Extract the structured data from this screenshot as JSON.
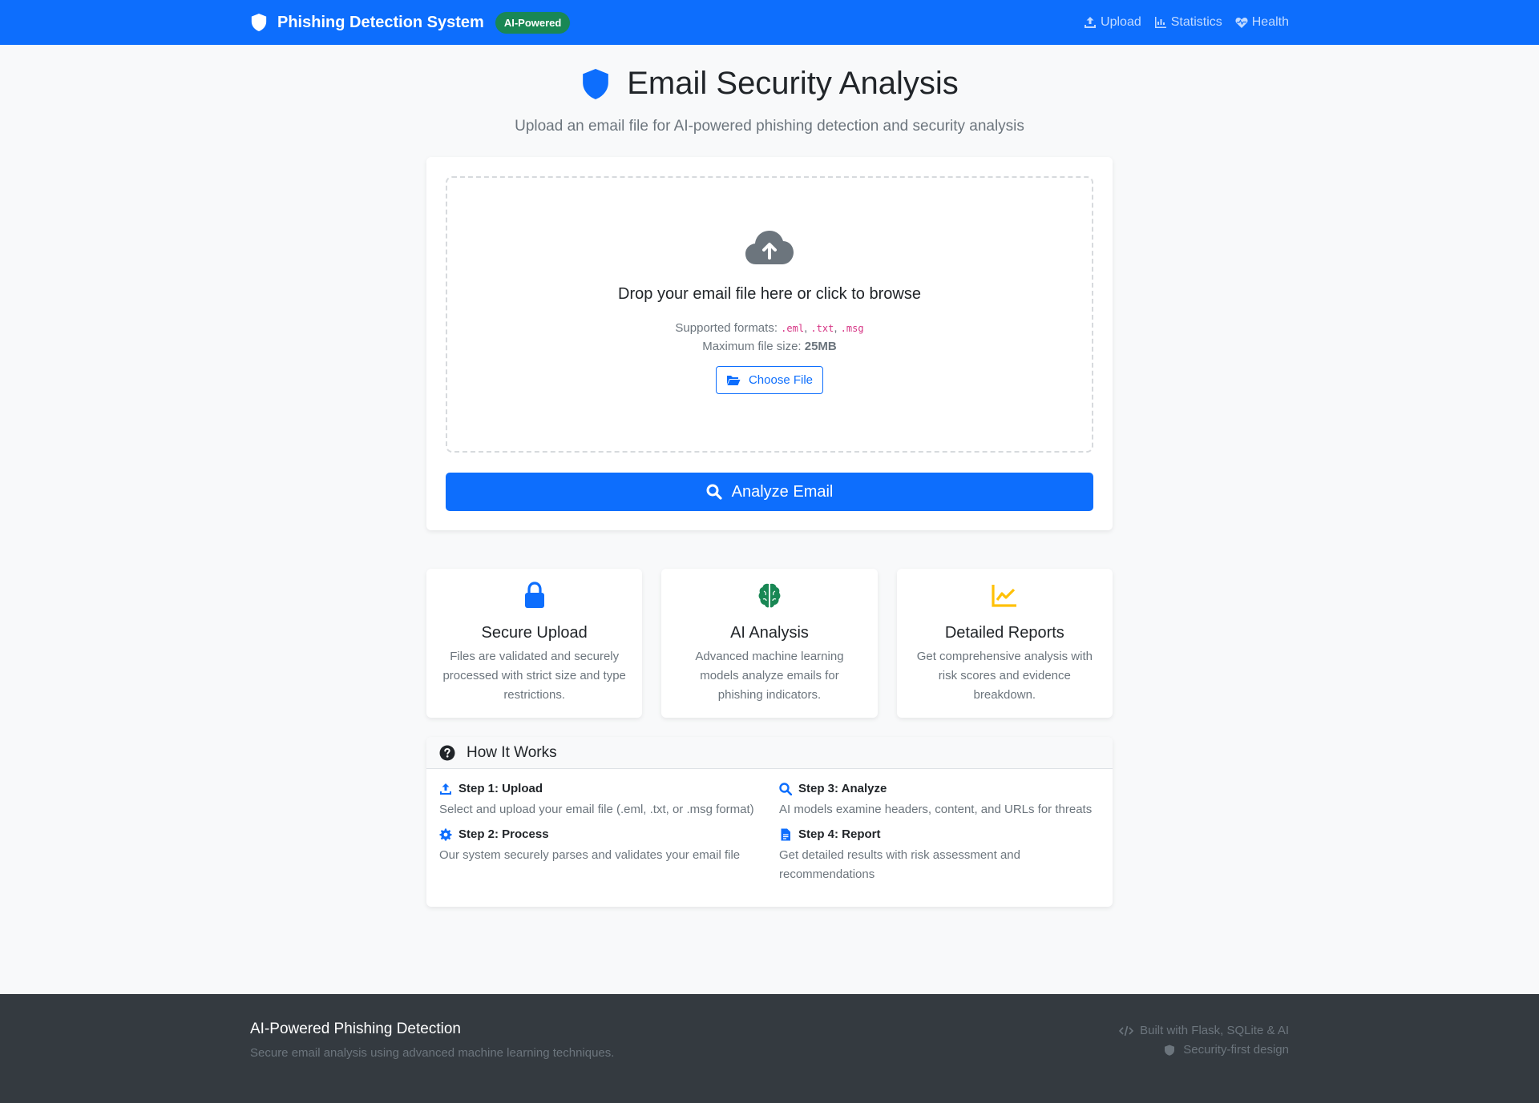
{
  "navbar": {
    "brand": "Phishing Detection System",
    "badge": "AI-Powered",
    "links": [
      {
        "label": "Upload",
        "icon": "upload-icon"
      },
      {
        "label": "Statistics",
        "icon": "chart-icon"
      },
      {
        "label": "Health",
        "icon": "heart-pulse-icon"
      }
    ]
  },
  "hero": {
    "title": "Email Security Analysis",
    "subtitle": "Upload an email file for AI-powered phishing detection and security analysis"
  },
  "upload": {
    "drop_title": "Drop your email file here or click to browse",
    "formats_label": "Supported formats:",
    "formats": [
      ".eml",
      ".txt",
      ".msg"
    ],
    "max_label": "Maximum file size:",
    "max_value": "25MB",
    "choose_label": "Choose File",
    "analyze_label": "Analyze Email"
  },
  "features": [
    {
      "title": "Secure Upload",
      "desc": "Files are validated and securely processed with strict size and type restrictions.",
      "icon": "lock-icon",
      "color": "#0d6efd"
    },
    {
      "title": "AI Analysis",
      "desc": "Advanced machine learning models analyze emails for phishing indicators.",
      "icon": "brain-icon",
      "color": "#198754"
    },
    {
      "title": "Detailed Reports",
      "desc": "Get comprehensive analysis with risk scores and evidence breakdown.",
      "icon": "chart-line-icon",
      "color": "#ffc107"
    }
  ],
  "how": {
    "title": "How It Works",
    "steps": [
      {
        "title": "Step 1: Upload",
        "desc": "Select and upload your email file (.eml, .txt, or .msg format)",
        "icon": "upload-icon"
      },
      {
        "title": "Step 3: Analyze",
        "desc": "AI models examine headers, content, and URLs for threats",
        "icon": "search-icon"
      },
      {
        "title": "Step 2: Process",
        "desc": "Our system securely parses and validates your email file",
        "icon": "gear-icon"
      },
      {
        "title": "Step 4: Report",
        "desc": "Get detailed results with risk assessment and recommendations",
        "icon": "file-icon"
      }
    ]
  },
  "footer": {
    "title": "AI-Powered Phishing Detection",
    "subtitle": "Secure email analysis using advanced machine learning techniques.",
    "built": "Built with Flask, SQLite & AI",
    "design": "Security-first design"
  },
  "colors": {
    "primary": "#0d6efd",
    "success": "#198754",
    "warning": "#ffc107",
    "footer_bg": "#343a40"
  }
}
